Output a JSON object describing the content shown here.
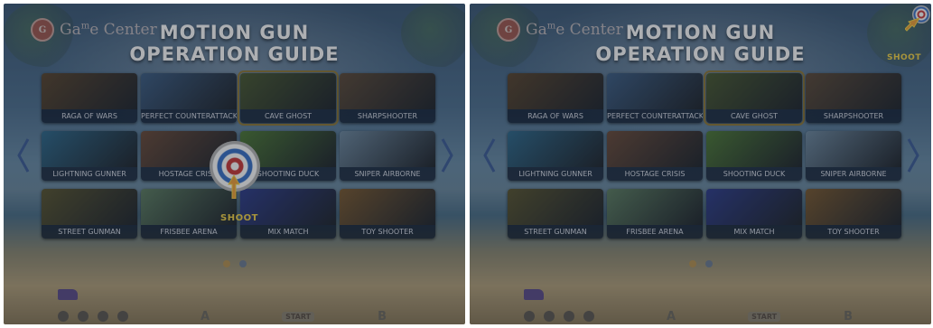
{
  "panels": [
    {
      "logo": {
        "text_pre": "Ga",
        "text_sup": "m",
        "text_post": "e Center",
        "badge": "G"
      },
      "title_line1": "MOTION GUN",
      "title_line2": "OPERATION GUIDE",
      "shoot_label": "SHOOT",
      "target_position": "center"
    },
    {
      "logo": {
        "text_pre": "Ga",
        "text_sup": "m",
        "text_post": "e Center",
        "badge": "G"
      },
      "title_line1": "MOTION GUN",
      "title_line2": "OPERATION GUIDE",
      "shoot_label": "SHOOT",
      "target_position": "top-right"
    }
  ],
  "games": [
    {
      "label": "RAGA OF WARS",
      "art": "#5a4630"
    },
    {
      "label": "PERFECT COUNTERATTACK",
      "art": "#3e5f86"
    },
    {
      "label": "CAVE GHOST",
      "art": "#4a5a33"
    },
    {
      "label": "SHARPSHOOTER",
      "art": "#5d4b3a"
    },
    {
      "label": "LIGHTNING GUNNER",
      "art": "#2f6a8d"
    },
    {
      "label": "HOSTAGE CRISIS",
      "art": "#6b4c3b"
    },
    {
      "label": "SHOOTING DUCK",
      "art": "#4e7a38"
    },
    {
      "label": "SNIPER AIRBORNE",
      "art": "#6f8aa1"
    },
    {
      "label": "STREET GUNMAN",
      "art": "#5a5632"
    },
    {
      "label": "FRISBEE ARENA",
      "art": "#5e7f63"
    },
    {
      "label": "MIX MATCH",
      "art": "#2f3e8c"
    },
    {
      "label": "TOY SHOOTER",
      "art": "#7a5a32"
    }
  ],
  "selected_game": "CAVE GHOST",
  "pagination": {
    "pages": 2,
    "active": 1
  },
  "colors": {
    "accent": "#f6d649",
    "selected_border": "#8f7a3a",
    "arrow": "#3e5f99"
  }
}
